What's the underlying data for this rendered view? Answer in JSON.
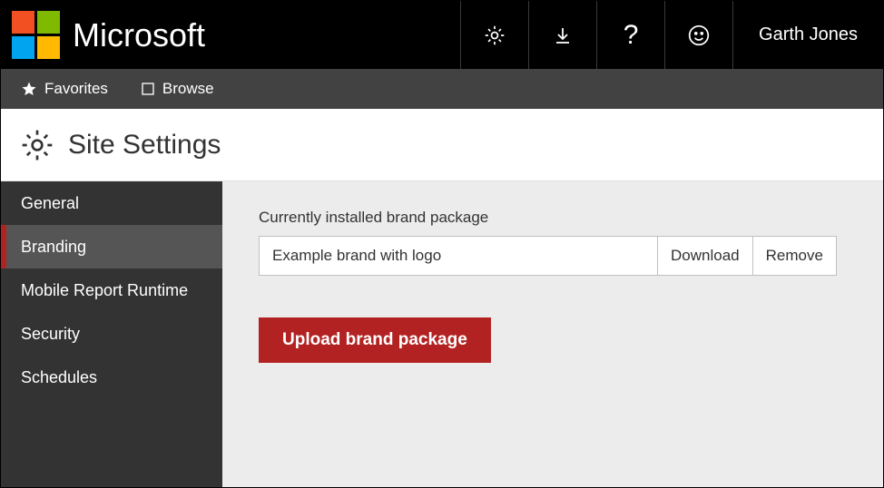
{
  "colors": {
    "accent_red": "#B22222",
    "logo": {
      "tl": "#F25022",
      "tr": "#7FBA00",
      "bl": "#00A4EF",
      "br": "#FFB900"
    }
  },
  "topbar": {
    "brand": "Microsoft",
    "user": "Garth Jones"
  },
  "secbar": {
    "favorites": "Favorites",
    "browse": "Browse"
  },
  "title": "Site Settings",
  "sidebar": {
    "items": [
      {
        "label": "General"
      },
      {
        "label": "Branding"
      },
      {
        "label": "Mobile Report Runtime"
      },
      {
        "label": "Security"
      },
      {
        "label": "Schedules"
      }
    ],
    "active_index": 1
  },
  "main": {
    "field_label": "Currently installed brand package",
    "field_value": "Example brand with logo",
    "download": "Download",
    "remove": "Remove",
    "upload": "Upload brand package"
  }
}
